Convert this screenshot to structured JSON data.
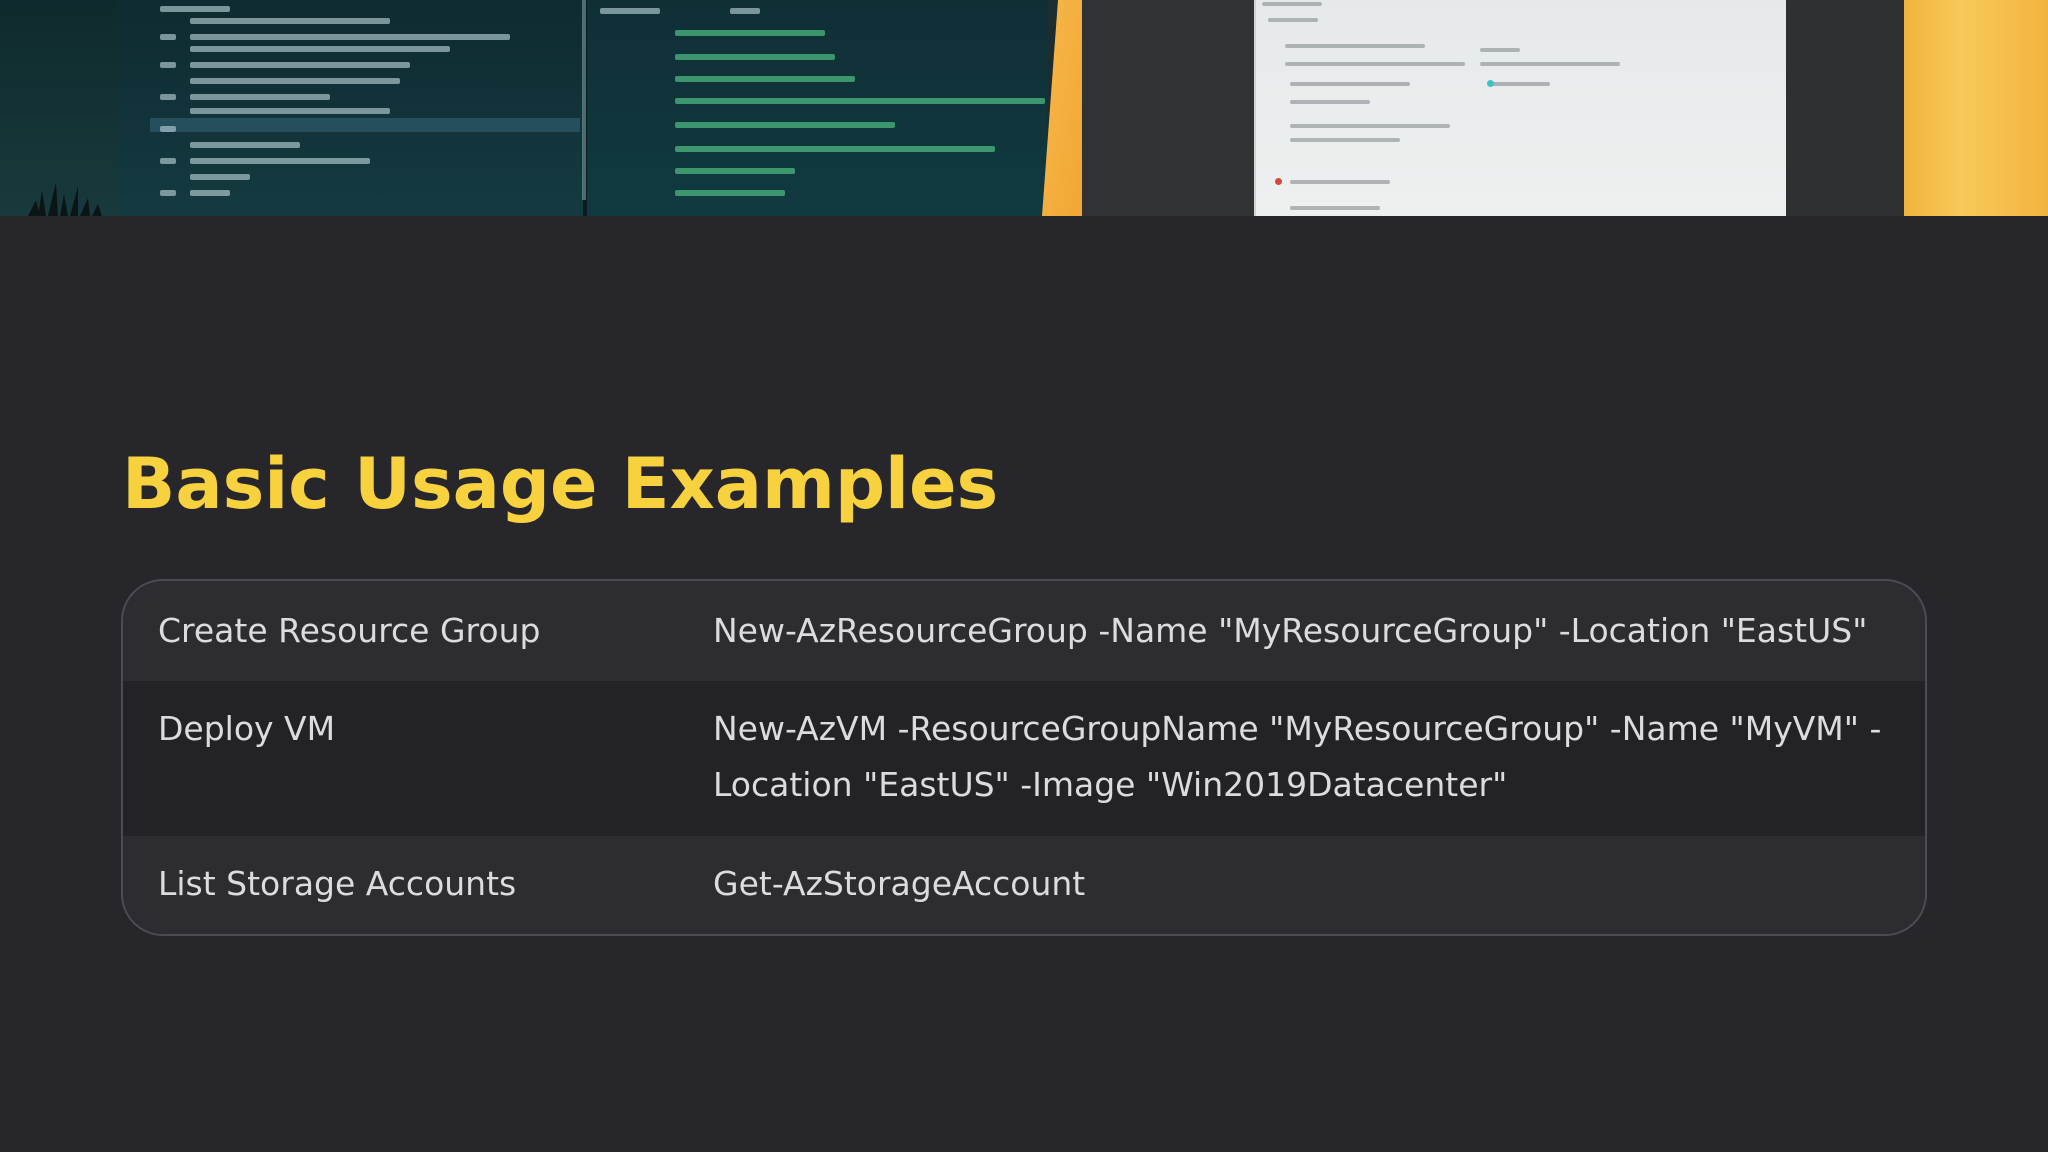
{
  "heading": "Basic Usage Examples",
  "colors": {
    "background": "#27272b",
    "heading": "#f7d23e",
    "text": "#dcdcde",
    "row_odd": "#2d2d31",
    "row_even": "#232327",
    "border": "#4c4c52"
  },
  "table": {
    "rows": [
      {
        "action": "Create Resource Group",
        "command": "New-AzResourceGroup -Name \"MyResourceGroup\" -Location \"EastUS\""
      },
      {
        "action": "Deploy VM",
        "command_lines": [
          "New-AzVM -ResourceGroupName \"MyResourceGroup\" -Name \"MyVM\" -",
          "Location \"EastUS\" -Image \"Win2019Datacenter\""
        ]
      },
      {
        "action": "List Storage Accounts",
        "command": "Get-AzStorageAccount"
      }
    ]
  }
}
